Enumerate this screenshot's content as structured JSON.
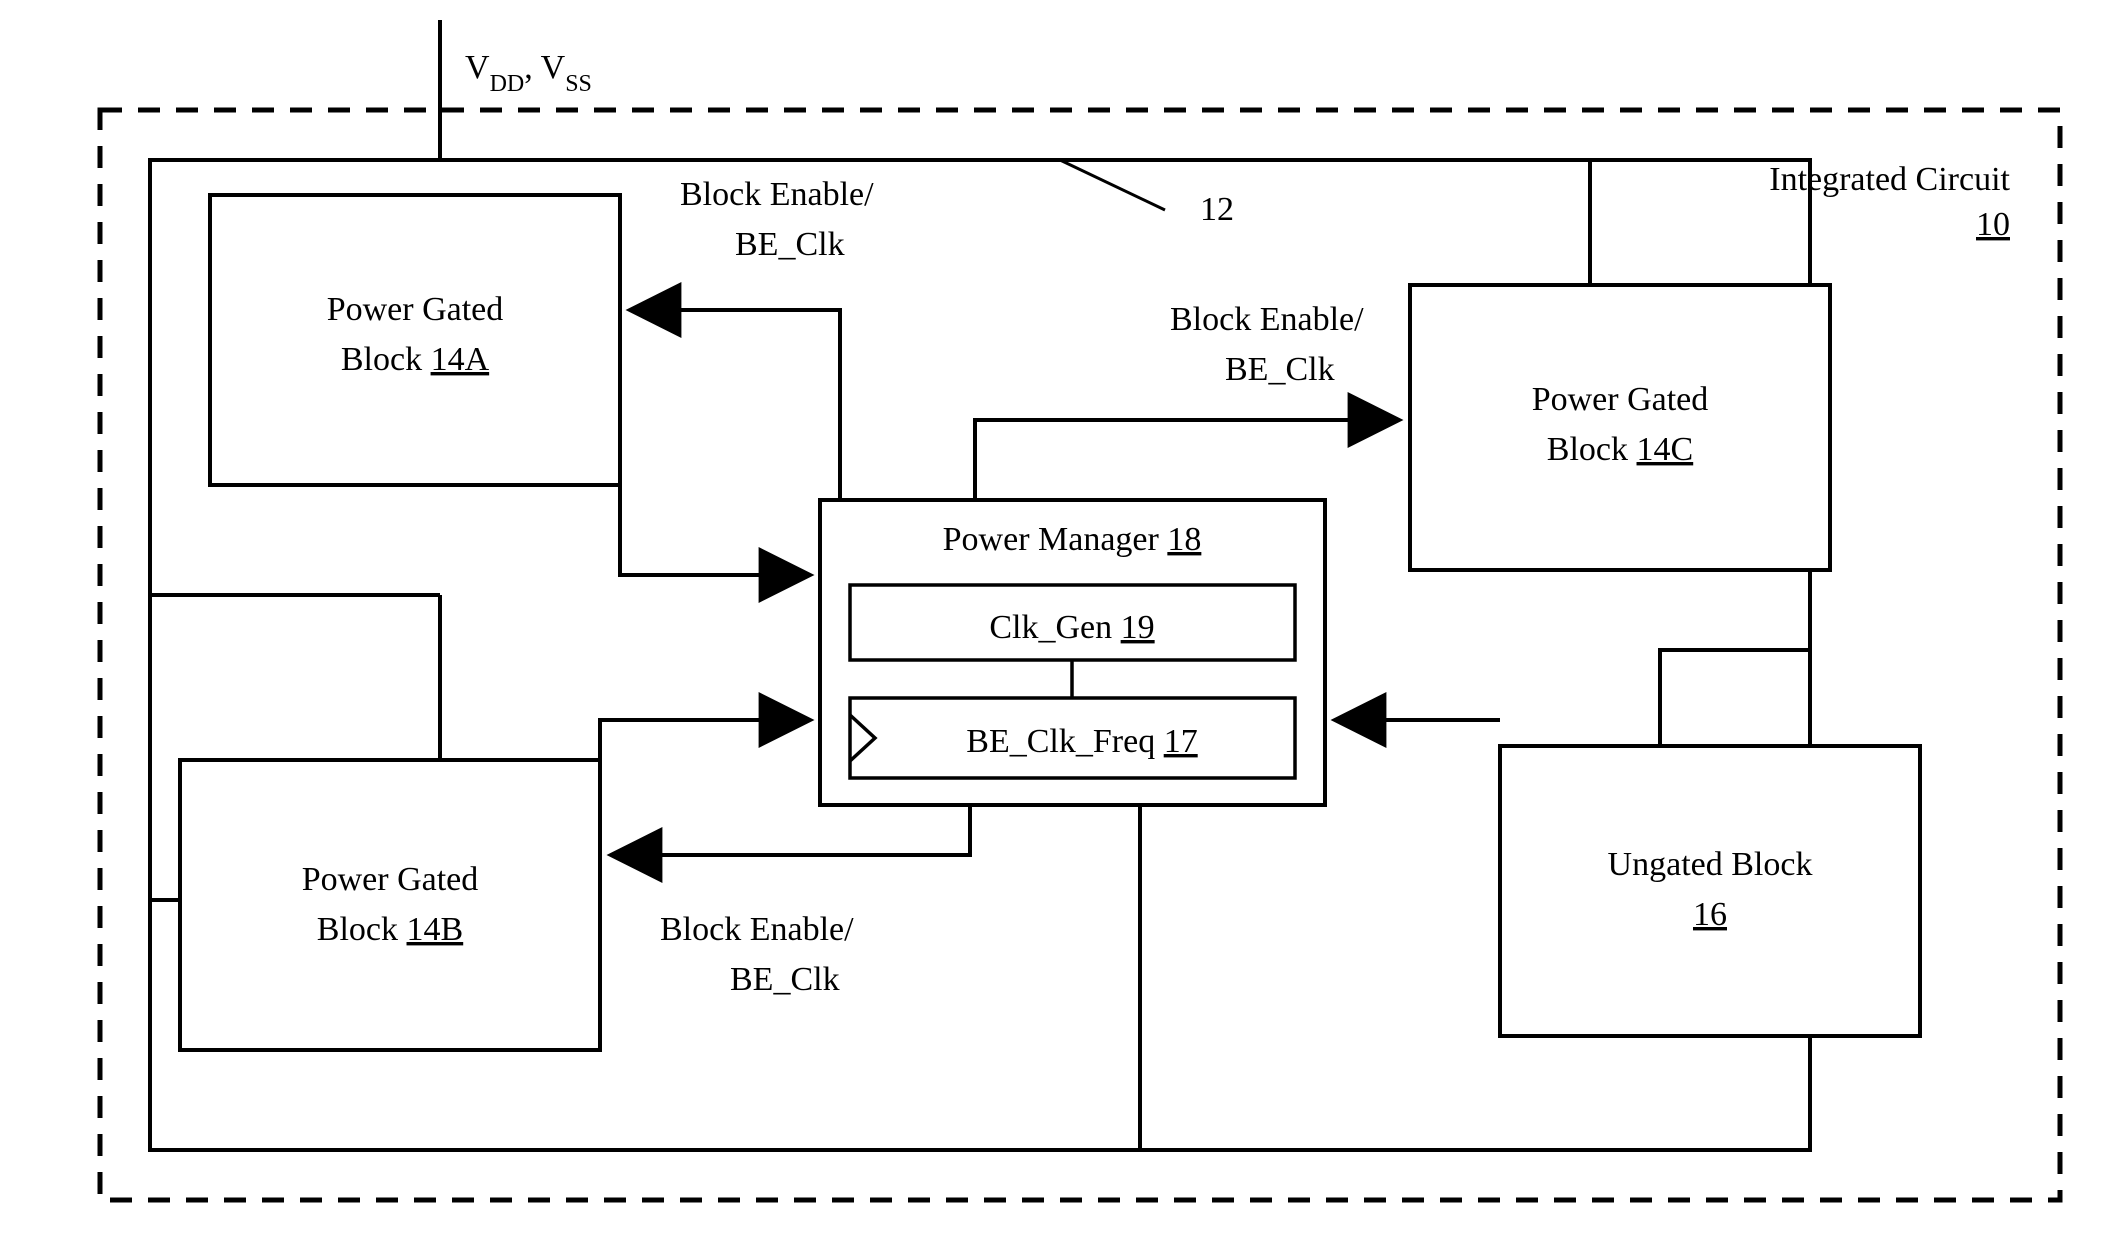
{
  "labels": {
    "vdd_vss_prefix": "V",
    "vdd_sub": "DD",
    "vss_sub": "SS",
    "chip_title": "Integrated Circuit",
    "chip_ref": "10",
    "ref12": "12",
    "block14A_line1": "Power Gated",
    "block14A_line2a": "Block ",
    "block14A_ref": "14A",
    "block14B_line1": "Power Gated",
    "block14B_line2a": "Block ",
    "block14B_ref": "14B",
    "block14C_line1": "Power Gated",
    "block14C_line2a": "Block ",
    "block14C_ref": "14C",
    "block16_line1": "Ungated Block",
    "block16_ref": "16",
    "pm_title_a": "Power Manager ",
    "pm_ref": "18",
    "clkgen_a": "Clk_Gen ",
    "clkgen_ref": "19",
    "beclkfreq_a": "BE_Clk_Freq ",
    "beclkfreq_ref": "17",
    "sig1_line1": "Block Enable/",
    "sig1_line2": "BE_Clk",
    "sig2_line1": "Block Enable/",
    "sig2_line2": "BE_Clk",
    "sig3_line1": "Block Enable/",
    "sig3_line2": "BE_Clk"
  }
}
